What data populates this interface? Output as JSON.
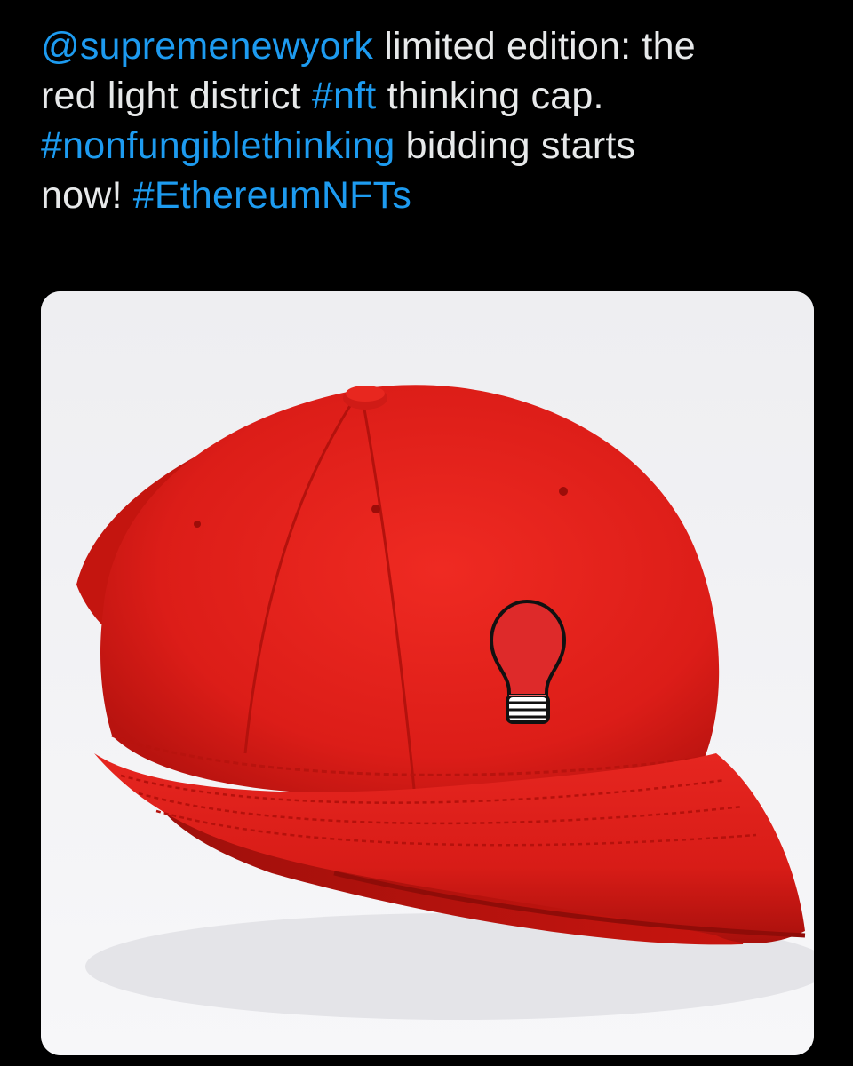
{
  "tweet": {
    "segments": {
      "mention": "@supremenewyork",
      "t1": " limited edition: the",
      "t2": "red light district ",
      "hashtag_nft": "#nft",
      "t3": " thinking cap.",
      "hashtag_nonfungible": "#nonfungiblethinking",
      "t4": " bidding starts",
      "t5": "now! ",
      "hashtag_eth": "#EthereumNFTs"
    }
  },
  "media": {
    "alt": "red baseball cap with embroidered light bulb"
  },
  "colors": {
    "background": "#000000",
    "text": "#e7e9ea",
    "link": "#1d9bf0",
    "cap_red": "#e0201c"
  }
}
